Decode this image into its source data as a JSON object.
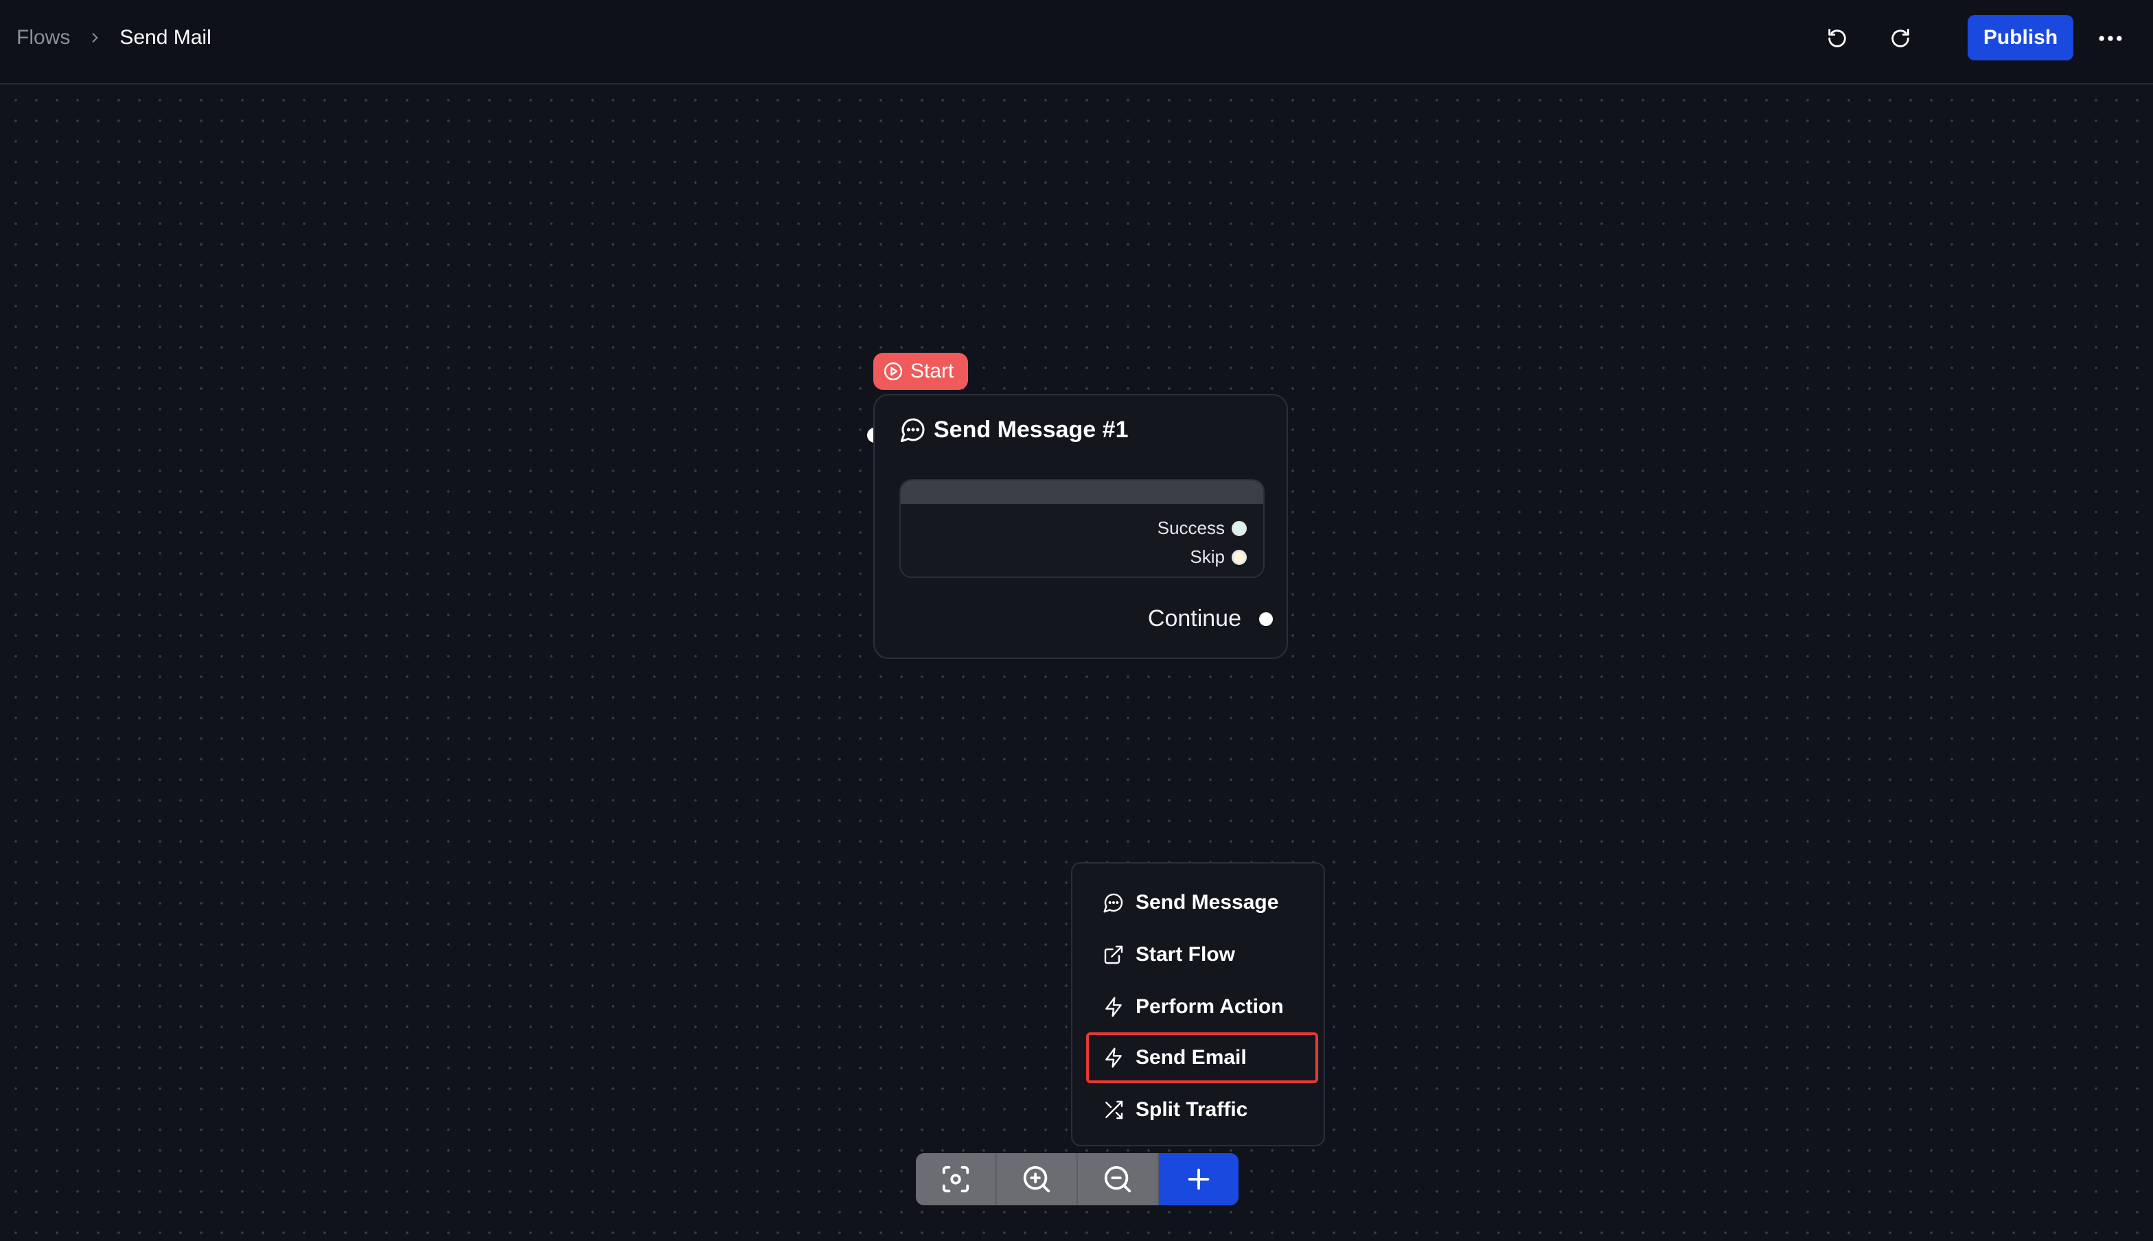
{
  "header": {
    "breadcrumb_root": "Flows",
    "breadcrumb_current": "Send Mail",
    "publish_label": "Publish"
  },
  "canvas": {
    "start_badge": "Start",
    "node": {
      "title": "Send Message #1",
      "outputs": [
        "Success",
        "Skip"
      ],
      "continue_label": "Continue"
    }
  },
  "add_menu": {
    "items": [
      {
        "label": "Send Message",
        "icon": "chat-bubble-icon"
      },
      {
        "label": "Start Flow",
        "icon": "external-link-icon"
      },
      {
        "label": "Perform Action",
        "icon": "lightning-icon"
      },
      {
        "label": "Send Email",
        "icon": "lightning-icon",
        "selected": true
      },
      {
        "label": "Split Traffic",
        "icon": "shuffle-icon"
      }
    ]
  },
  "toolbar": {
    "buttons": [
      "fit-view-icon",
      "zoom-in-icon",
      "zoom-out-icon",
      "plus-icon"
    ]
  },
  "colors": {
    "accent": "#1a49e0",
    "start": "#f05a5a",
    "success": "#3ec291",
    "skip": "#f1b929",
    "selected_outline": "#e53935"
  }
}
